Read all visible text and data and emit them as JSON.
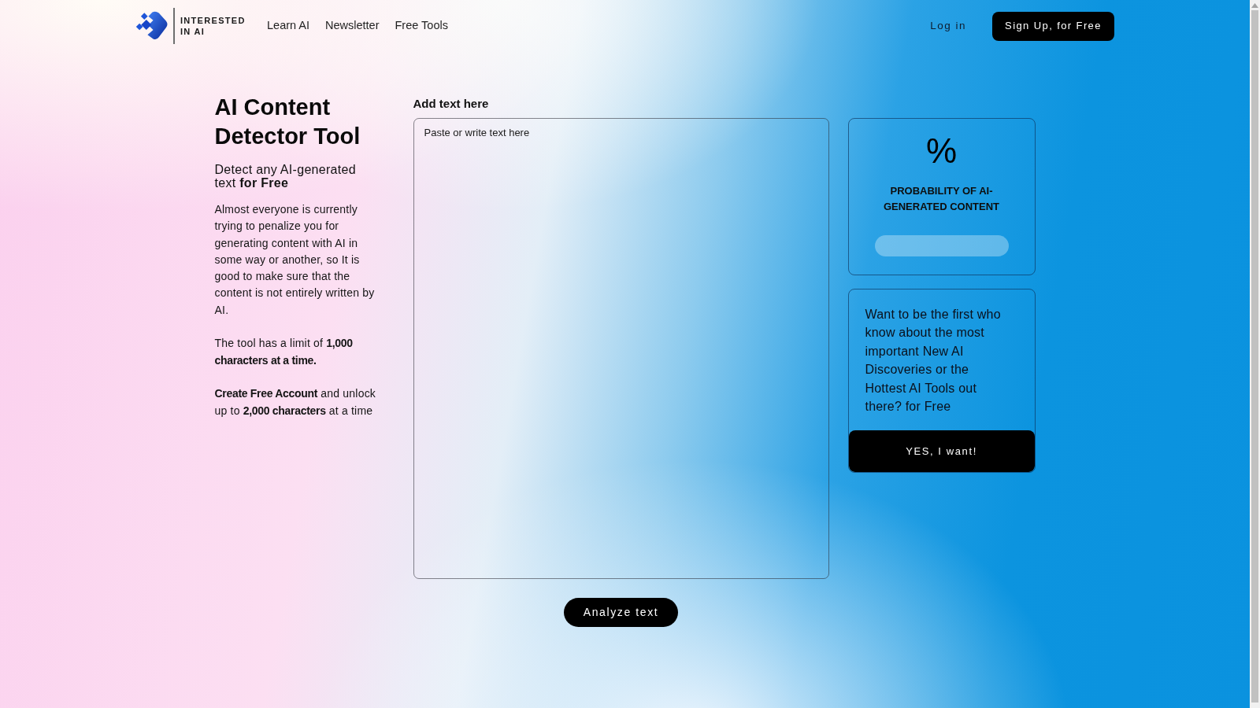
{
  "header": {
    "logo": {
      "text": "INTERESTED IN AI"
    },
    "nav": [
      {
        "label": "Learn AI"
      },
      {
        "label": "Newsletter"
      },
      {
        "label": "Free Tools"
      }
    ],
    "login": "Log in",
    "signup": "Sign Up, for Free"
  },
  "intro": {
    "title": "AI Content Detector Tool",
    "subtitle": "Detect any AI-generated text **for Free**",
    "paragraphs": [
      "Almost everyone is currently trying to penalize you for generating content with AI in some way or another, so It is good to make sure that the content is not entirely written by AI.",
      "The tool has a limit of **1,000 characters at a time.**",
      "**Create Free Account** and unlock up to **2,000 characters** at a time"
    ]
  },
  "editor": {
    "label": "Add text here",
    "placeholder": "Paste or write text here",
    "button": "Analyze text"
  },
  "result": {
    "value": "%",
    "label": "PROBABILITY OF AI-GENERATED CONTENT",
    "level": 0
  },
  "promo": {
    "text": "Want to be the first who know about the most important New AI Discoveries or the Hottest AI Tools out there? for Free",
    "button": "YES, I want!"
  }
}
